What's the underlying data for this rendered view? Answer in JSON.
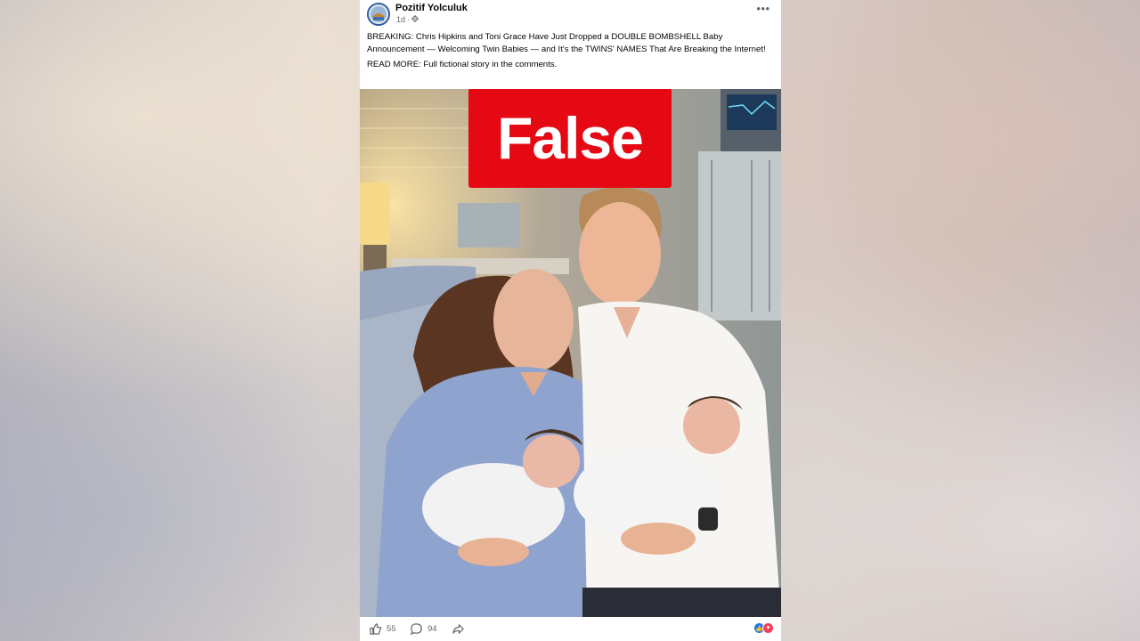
{
  "post": {
    "page_name": "Pozitif Yolculuk",
    "time": "1d",
    "privacy_separator": "·",
    "privacy_icon": "gear-icon",
    "more_icon": "more-dots-icon",
    "more_label": "•••",
    "text_lines": [
      "BREAKING: Chris Hipkins and Toni Grace Have Just Dropped a DOUBLE BOMBSHELL Baby Announcement — Welcoming Twin Babies — and It's the TWINS' NAMES That Are Breaking the Internet!",
      "READ MORE: Full fictional story in the comments."
    ]
  },
  "image": {
    "label": "False",
    "label_color": "#e50914",
    "description_icon": "photo"
  },
  "footer": {
    "like_count": "55",
    "comment_count": "94",
    "like_icon": "thumbs-up-icon",
    "comment_icon": "comment-icon",
    "share_icon": "share-icon",
    "reaction_like_glyph": "👍",
    "reaction_love_glyph": "♥"
  },
  "colors": {
    "accent": "#1877f2",
    "love": "#f33e58",
    "text_primary": "#050505",
    "text_secondary": "#65676b"
  }
}
